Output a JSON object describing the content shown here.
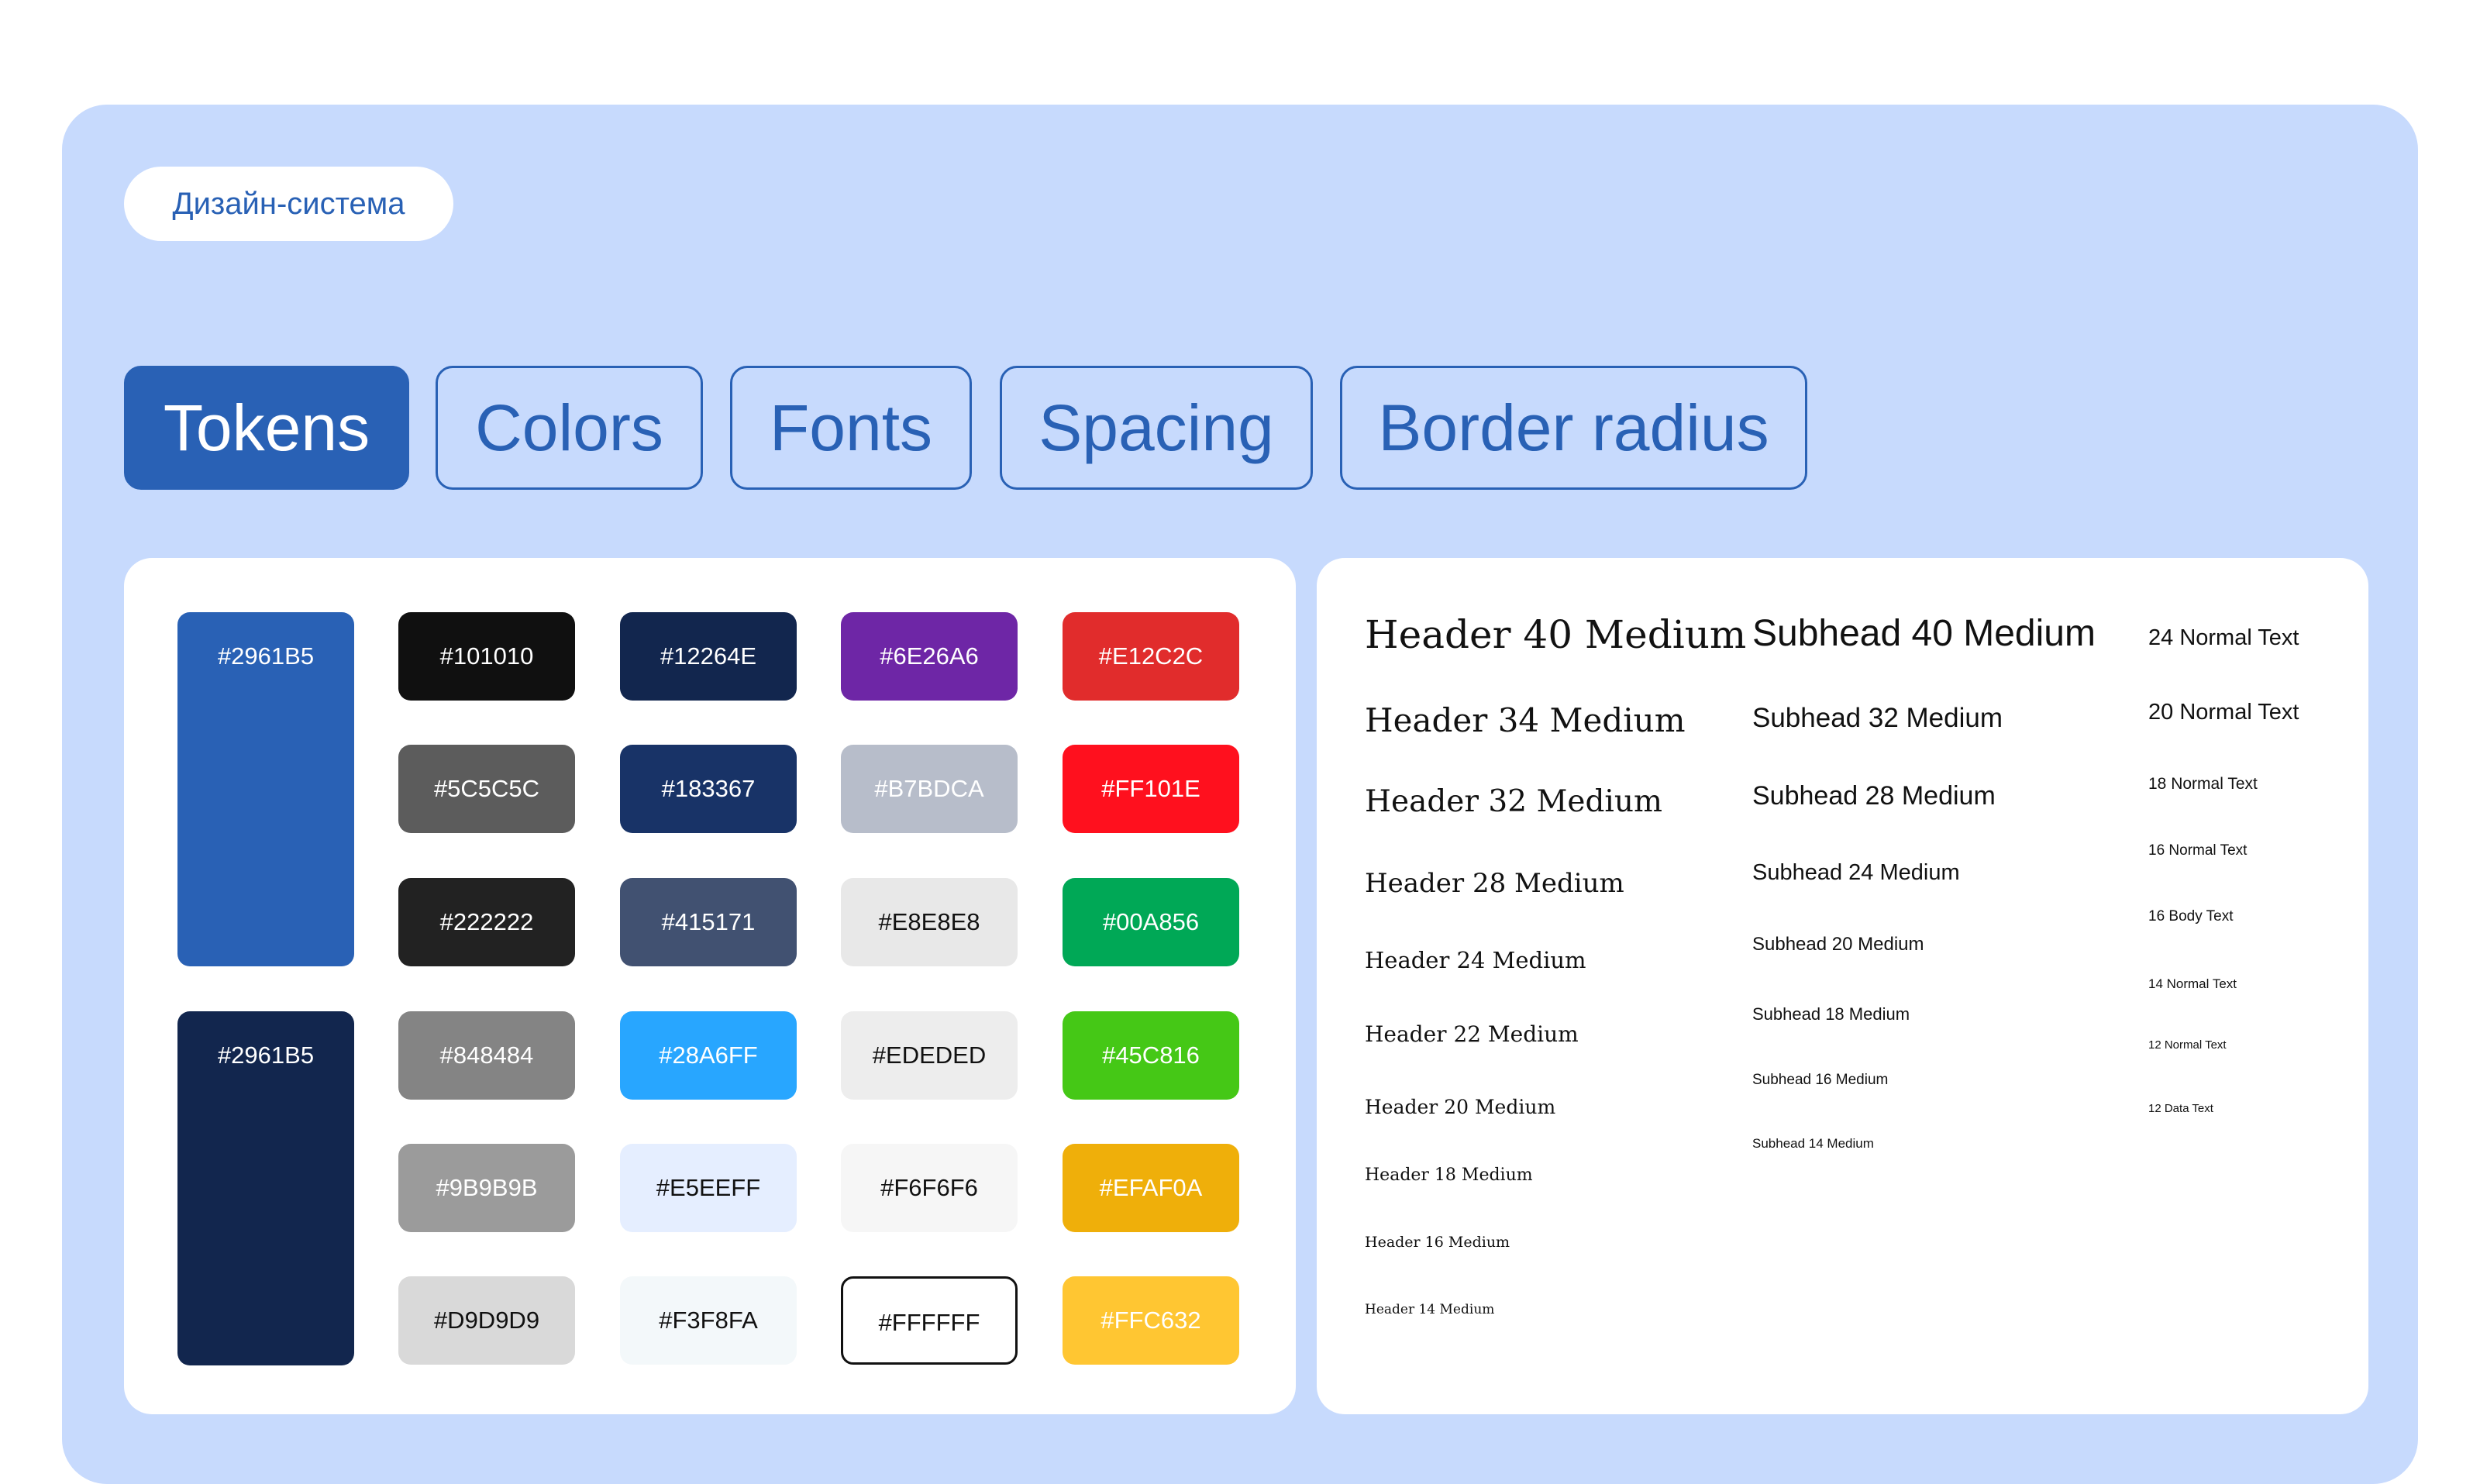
{
  "badge": "Дизайн-система",
  "tabs": [
    {
      "label": "Tokens",
      "active": true
    },
    {
      "label": "Colors",
      "active": false
    },
    {
      "label": "Fonts",
      "active": false
    },
    {
      "label": "Spacing",
      "active": false
    },
    {
      "label": "Border radius",
      "active": false
    }
  ],
  "palette": {
    "primary_blue": "#2961B5",
    "primary_dark": "#2961B5",
    "swatches": [
      [
        "#101010",
        "#12264E",
        "#6E26A6",
        "#E12C2C"
      ],
      [
        "#5C5C5C",
        "#183367",
        "#B7BDCA",
        "#FF101E"
      ],
      [
        "#222222",
        "#415171",
        "#E8E8E8",
        "#00A856"
      ],
      [
        "#848484",
        "#28A6FF",
        "#EDEDED",
        "#45C816"
      ],
      [
        "#9B9B9B",
        "#E5EEFF",
        "#F6F6F6",
        "#EFAF0A"
      ],
      [
        "#D9D9D9",
        "#F3F8FA",
        "#FFFFFF",
        "#FFC632"
      ]
    ]
  },
  "fonts": {
    "headers": [
      "Header 40 Medium",
      "Header 34 Medium",
      "Header 32 Medium",
      "Header 28 Medium",
      "Header 24 Medium",
      "Header 22 Medium",
      "Header 20 Medium",
      "Header 18 Medium",
      "Header 16 Medium",
      "Header 14 Medium"
    ],
    "subheads": [
      "Subhead 40 Medium",
      "Subhead 32 Medium",
      "Subhead 28 Medium",
      "Subhead 24 Medium",
      "Subhead 20 Medium",
      "Subhead 18 Medium",
      "Subhead 16 Medium",
      "Subhead 14 Medium"
    ],
    "texts": [
      "24 Normal Text",
      "20 Normal Text",
      "18 Normal Text",
      "16 Normal Text",
      "16 Body Text",
      "14 Normal Text",
      "12 Normal Text",
      "12 Data Text"
    ]
  },
  "colors": {
    "panel_bg": "#C7DAFD",
    "accent": "#2961B5",
    "dark_navy": "#12264E"
  }
}
